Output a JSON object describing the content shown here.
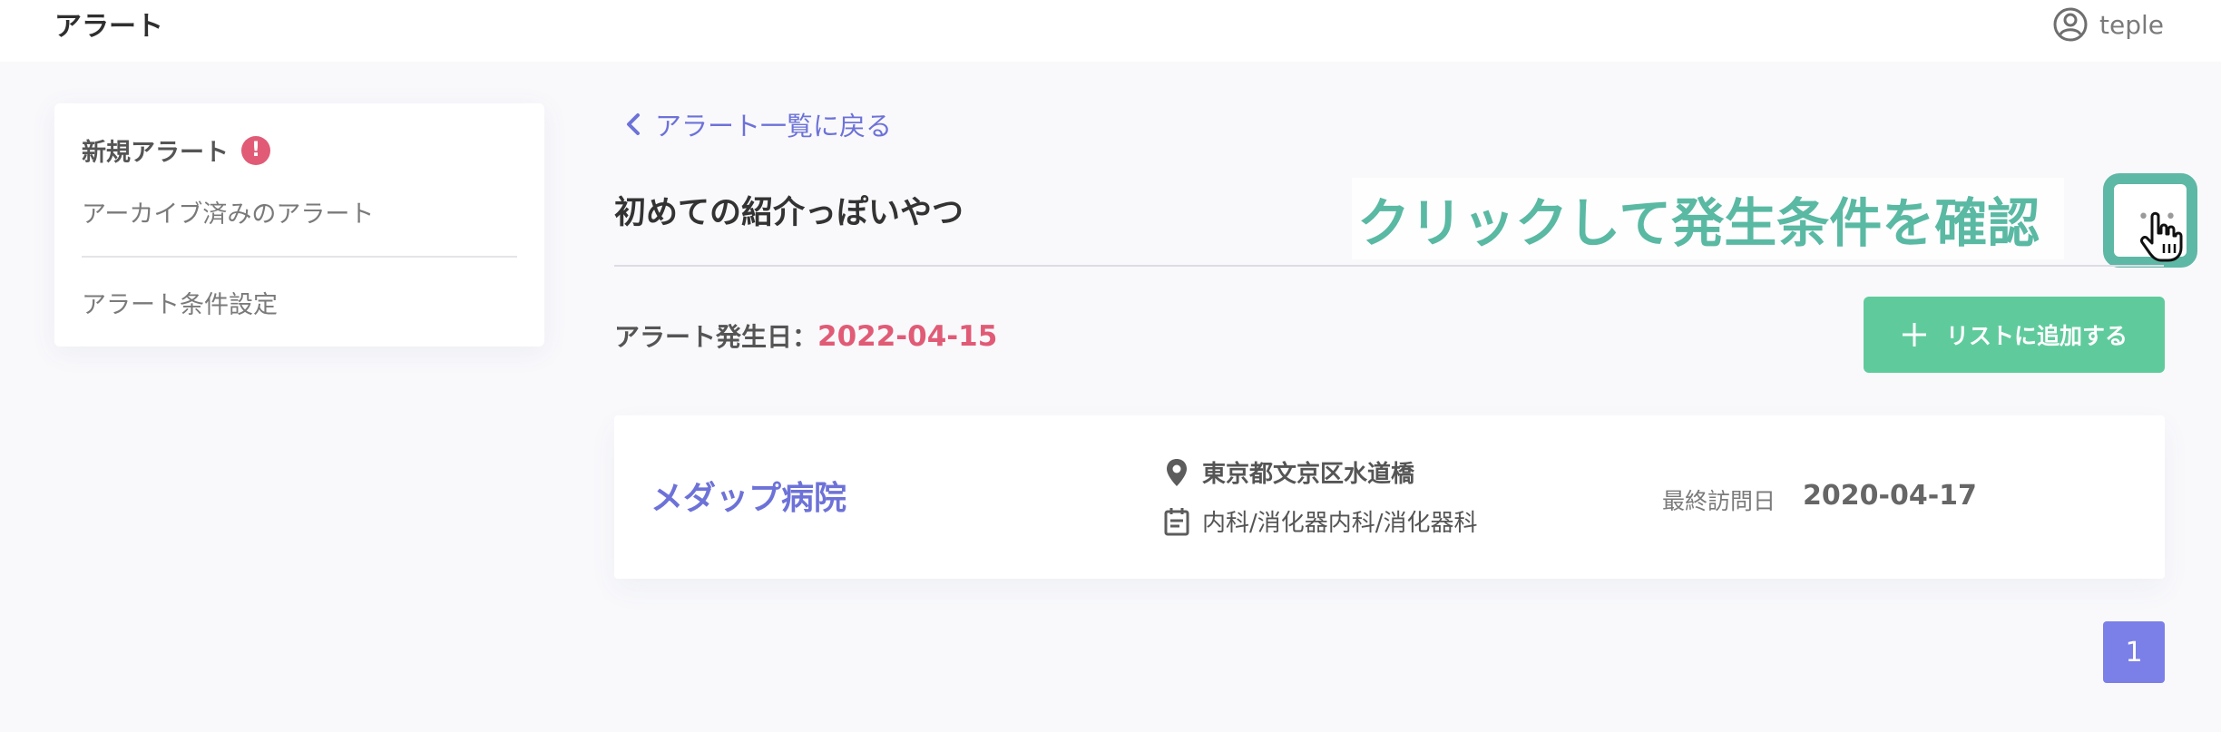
{
  "header": {
    "title": "アラート",
    "user_name": "teple"
  },
  "sidebar": {
    "new_alert_label": "新規アラート",
    "new_alert_badge": "!",
    "archived_label": "アーカイブ済みのアラート",
    "settings_label": "アラート条件設定"
  },
  "main": {
    "back_label": "アラート一覧に戻る",
    "alert_title": "初めての紹介っぽいやつ",
    "callout_text": "クリックして発生条件を確認",
    "more_dots": "•••",
    "date_label": "アラート発生日：",
    "date_value": "2022-04-15",
    "add_button_label": "リストに追加する"
  },
  "result": {
    "hospital_name": "メダップ病院",
    "location": "東京都文京区水道橋",
    "departments": "内科/消化器内科/消化器科",
    "last_visit_label": "最終訪問日",
    "last_visit_date": "2020-04-17"
  },
  "pagination": {
    "current_page": "1"
  },
  "colors": {
    "accent": "#6d72d8",
    "alert": "#e15b76",
    "add_button": "#5fcb9c",
    "callout": "#5ab9a3",
    "page_button": "#7b7fe8"
  }
}
